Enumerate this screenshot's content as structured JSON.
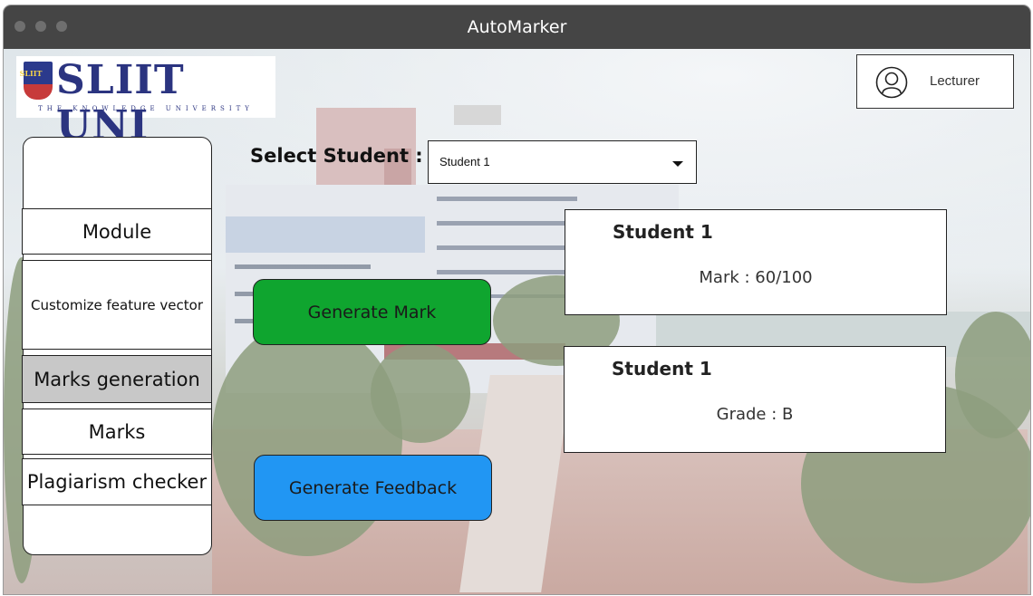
{
  "window": {
    "title": "AutoMarker"
  },
  "logo": {
    "crest_text": "SLIIT",
    "name": "SLIIT UNI",
    "tagline": "THE KNOWLEDGE UNIVERSITY"
  },
  "user": {
    "role": "Lecturer",
    "icon": "user-icon"
  },
  "sidebar": {
    "items": [
      {
        "label": "Module"
      },
      {
        "label": "Customize feature vector"
      },
      {
        "label": "Marks generation",
        "active": true
      },
      {
        "label": "Marks"
      },
      {
        "label": "Plagiarism checker"
      }
    ]
  },
  "student_select": {
    "label": "Select Student :",
    "selected": "Student 1"
  },
  "buttons": {
    "generate_mark": "Generate Mark",
    "generate_feedback": "Generate Feedback"
  },
  "results": {
    "mark_card": {
      "student": "Student 1",
      "value": "Mark : 60/100"
    },
    "grade_card": {
      "student": "Student 1",
      "value": "Grade : B"
    }
  },
  "colors": {
    "generate_mark": "#0fa52f",
    "generate_feedback": "#2196f3",
    "titlebar": "#454545",
    "active_menu": "#c8c8c8"
  }
}
